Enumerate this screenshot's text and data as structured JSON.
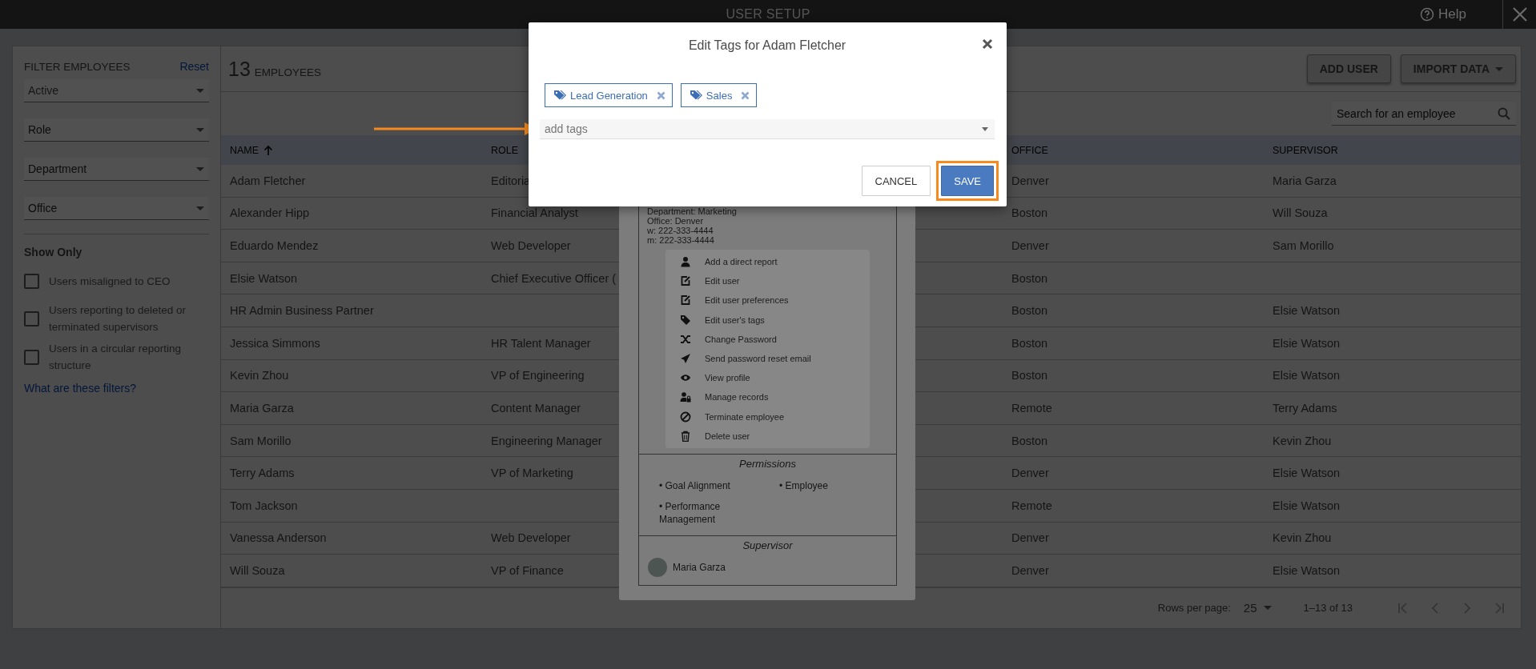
{
  "top_bar": {
    "title": "USER SETUP",
    "help": "Help"
  },
  "filters": {
    "title": "FILTER EMPLOYEES",
    "reset": "Reset",
    "dropdowns": [
      {
        "value": "Active"
      },
      {
        "placeholder": "Role"
      },
      {
        "placeholder": "Department"
      },
      {
        "placeholder": "Office"
      }
    ],
    "show_only_title": "Show Only",
    "checkboxes": [
      {
        "label": "Users misaligned to CEO",
        "checked": false
      },
      {
        "label": "Users reporting to deleted or terminated supervisors",
        "checked": false
      },
      {
        "label": "Users in a circular reporting structure",
        "checked": false
      }
    ],
    "help_link": "What are these filters?"
  },
  "employees": {
    "count": "13",
    "count_label": "EMPLOYEES",
    "buttons": [
      {
        "label": "ADD USER",
        "kind": "plain"
      },
      {
        "label": "IMPORT DATA",
        "kind": "dropdown"
      }
    ]
  },
  "search": {
    "placeholder": "Search for an employee"
  },
  "table": {
    "columns": [
      {
        "label": "NAME",
        "sorted": true
      },
      {
        "label": "ROLE",
        "sorted": false
      },
      {
        "label": "OFFICE",
        "sorted": false
      },
      {
        "label": "SUPERVISOR",
        "sorted": false
      }
    ],
    "rows": [
      {
        "name": "Adam Fletcher",
        "role": "Editoria",
        "office": "Denver",
        "supervisor": "Maria Garza"
      },
      {
        "name": "Alexander Hipp",
        "role": "Financial Analyst",
        "office": "Boston",
        "supervisor": "Will Souza"
      },
      {
        "name": "Eduardo Mendez",
        "role": "Web Developer",
        "office": "Denver",
        "supervisor": "Sam Morillo"
      },
      {
        "name": "Elsie Watson",
        "role": "Chief Executive Officer (",
        "office": "Boston",
        "supervisor": ""
      },
      {
        "name": "HR Admin Business Partner",
        "role": "",
        "office": "Boston",
        "supervisor": "Elsie Watson"
      },
      {
        "name": "Jessica Simmons",
        "role": "HR Talent Manager",
        "office": "Boston",
        "supervisor": "Elsie Watson"
      },
      {
        "name": "Kevin Zhou",
        "role": "VP of Engineering",
        "office": "Boston",
        "supervisor": "Elsie Watson"
      },
      {
        "name": "Maria Garza",
        "role": "Content Manager",
        "office": "Remote",
        "supervisor": "Terry Adams"
      },
      {
        "name": "Sam Morillo",
        "role": "Engineering Manager",
        "office": "Boston",
        "supervisor": "Kevin Zhou"
      },
      {
        "name": "Terry Adams",
        "role": "VP of Marketing",
        "office": "Denver",
        "supervisor": "Elsie Watson"
      },
      {
        "name": "Tom Jackson",
        "role": "",
        "office": "Remote",
        "supervisor": "Elsie Watson"
      },
      {
        "name": "Vanessa Anderson",
        "role": "Web Developer",
        "office": "Denver",
        "supervisor": "Kevin Zhou"
      },
      {
        "name": "Will Souza",
        "role": "VP of Finance",
        "office": "Denver",
        "supervisor": "Elsie Watson"
      }
    ]
  },
  "pagination": {
    "rows_per_page_label": "Rows per page:",
    "rows_per_page": "25",
    "range": "1–13 of 13"
  },
  "user_card": {
    "details": [
      "Department: Marketing",
      "Office: Denver",
      "w: 222-333-4444",
      "m: 222-333-4444"
    ],
    "actions": [
      {
        "label": "Add a direct report",
        "kind": "person"
      },
      {
        "label": "Edit user",
        "kind": "edit"
      },
      {
        "label": "Edit user preferences",
        "kind": "edit"
      },
      {
        "label": "Edit user's tags",
        "kind": "tags"
      },
      {
        "label": "Change Password",
        "kind": "shuffle"
      },
      {
        "label": "Send password reset email",
        "kind": "send"
      },
      {
        "label": "View profile",
        "kind": "eye"
      },
      {
        "label": "Manage records",
        "kind": "person-lock"
      },
      {
        "label": "Terminate employee",
        "kind": "ban"
      },
      {
        "label": "Delete user",
        "kind": "trash"
      }
    ],
    "permissions_title": "Permissions",
    "permissions": [
      "• Goal Alignment",
      "• Employee",
      "• Performance Management"
    ],
    "supervisor_title": "Supervisor",
    "supervisor": "Maria Garza"
  },
  "modal": {
    "title": "Edit Tags for Adam Fletcher",
    "tags": [
      "Lead Generation",
      "Sales"
    ],
    "tag_input": {
      "placeholder": "add tags"
    },
    "buttons": [
      {
        "label": "CANCEL",
        "kind": "secondary",
        "highlighted": false
      },
      {
        "label": "SAVE",
        "kind": "primary",
        "highlighted": true
      }
    ]
  }
}
